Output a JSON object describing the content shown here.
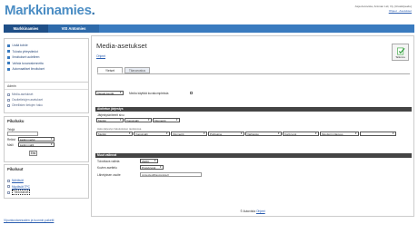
{
  "header": {
    "logo": "Markkinamies",
    "user_line": "Asja Autovista, Antman Ltd, Oy (Uloskirjaudu)",
    "links_line": "Ohjeet · Asetukset"
  },
  "nav": {
    "tabs": [
      "Markkinamies",
      "VIS Antomies"
    ]
  },
  "sidebar": {
    "menu": [
      "Lisää kohde",
      "Tulosta yhteystiedot",
      "Ilmoitukset uudelleen",
      "Vaihda kuvanrakennetta",
      "Automaattiset ilmoitukset"
    ],
    "admin_title": "Admin",
    "admin_items": [
      "Media-asetukset",
      "Osoitetietojen asetukset",
      "Oleellisten tietojen haku"
    ],
    "login_title": "Pikahaku",
    "login_labels": [
      "Tekijä",
      "Rekist",
      "Malli"
    ],
    "login_values": [
      "",
      "kaikki merkit",
      "kaikki mallit"
    ],
    "login_button": "Etsi",
    "pick_title": "Pikahaut",
    "pick_items": [
      "Nähtävät",
      "Myytävät TPC",
      "Tiedotukset"
    ],
    "bottom_link": "Vipunkustannusten ja tuonnin paketti"
  },
  "content": {
    "title": "Media-asetukset",
    "help_link": "Ohjeet",
    "save_label": "Tallenna",
    "tabs": [
      "Yleiset",
      "Tilavarustus"
    ],
    "row1": {
      "select": "Vapaat kentät",
      "label": "Media käyttää kuvakompleksia"
    },
    "section1": {
      "title": "Aloitetun järjestys",
      "sub_label": "Järjestyskriteerit sivu",
      "sub_selects": [
        "Merkki",
        "Vuosimalli",
        "Kilometrit"
      ],
      "sub2_label": "Haku järjestys hakutulosten taulukossa",
      "row2_selects": [
        "Merkki",
        "Vuosimalli",
        "Kilometrit",
        "Polttoaine",
        "Vaihteisto",
        "Korityyppi",
        "Moottorin tilavuus",
        ""
      ]
    },
    "section2": {
      "title": "Muut valinnat",
      "rows": [
        {
          "label": "Toivottava valinta",
          "value": "ZERO"
        },
        {
          "label": "Kuvien asettelu",
          "value": "Pystytyyppi"
        },
        {
          "label": "Lähetyksen osoite",
          "value": "protected@autovista.fi"
        }
      ]
    },
    "footer": {
      "text": "© Autovista",
      "link": "Ohjeet"
    }
  },
  "colors": {
    "accent": "#3a7bbf",
    "nav_dark": "#1f4f87",
    "section_bar": "#444444",
    "save_icon": "#4caf50"
  }
}
